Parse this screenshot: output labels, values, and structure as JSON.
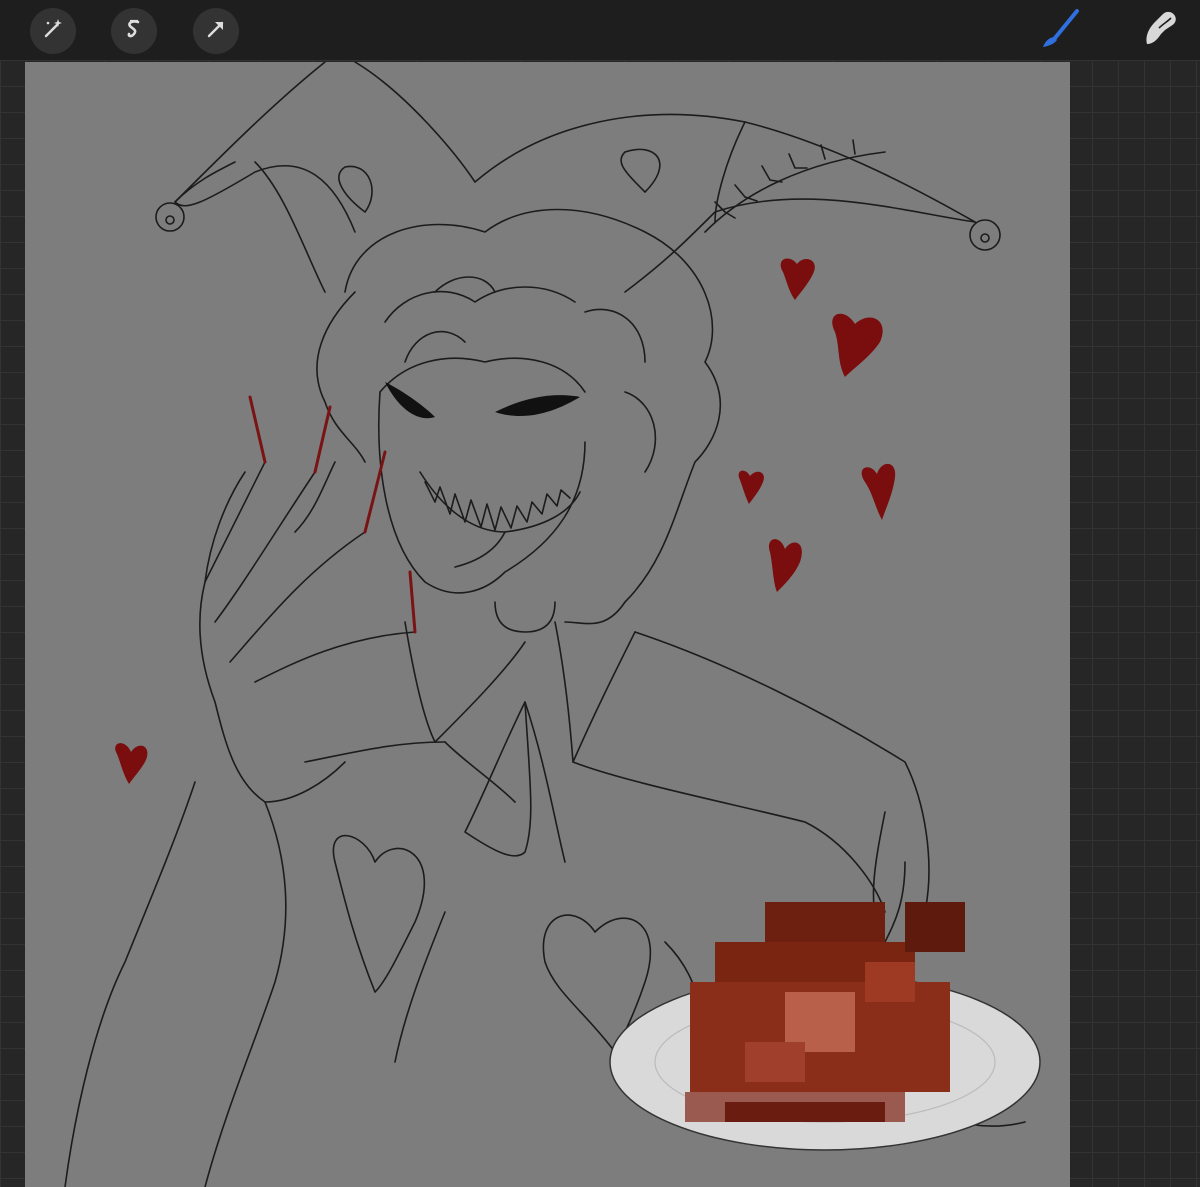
{
  "toolbar": {
    "left_tools": [
      {
        "icon": "magic-wand-icon"
      },
      {
        "icon": "selection-icon"
      },
      {
        "icon": "transform-arrow-icon"
      }
    ],
    "right_tools": [
      {
        "icon": "brush-icon",
        "color": "#2f6fe0",
        "active": true
      },
      {
        "icon": "smudge-icon",
        "color": "#d8d8d8",
        "active": false
      }
    ]
  },
  "canvas": {
    "background_color": "#7d7d7d",
    "artwork": "jester-sketch",
    "accent_color": "#7a0d0d",
    "plate_color": "#d9d9d9",
    "food_color": "#8a2e1a"
  }
}
